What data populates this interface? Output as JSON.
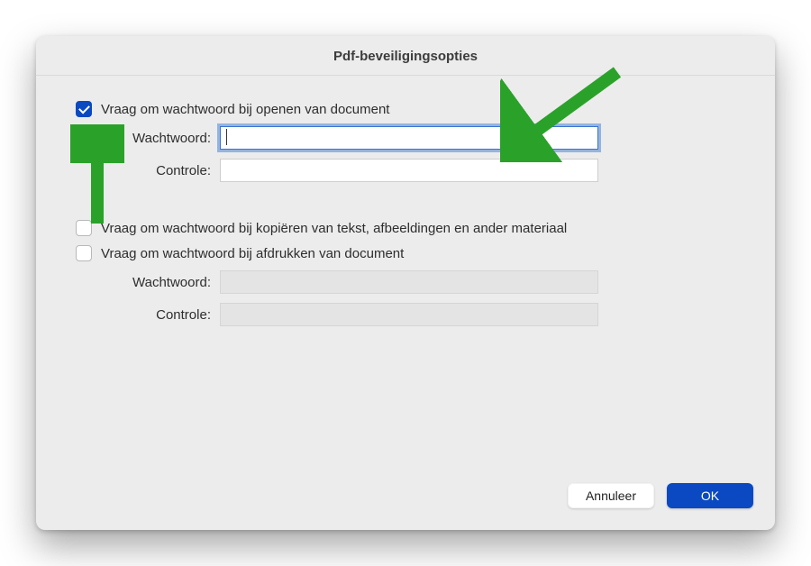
{
  "dialog": {
    "title": "Pdf-beveiligingsopties"
  },
  "open_section": {
    "checkbox_label": "Vraag om wachtwoord bij openen van document",
    "password_label": "Wachtwoord:",
    "verify_label": "Controle:",
    "password_value": "",
    "verify_value": ""
  },
  "permissions_section": {
    "copy_checkbox_label": "Vraag om wachtwoord bij kopiëren van tekst, afbeeldingen en ander materiaal",
    "print_checkbox_label": "Vraag om wachtwoord bij afdrukken van document",
    "password_label": "Wachtwoord:",
    "verify_label": "Controle:",
    "password_value": "",
    "verify_value": ""
  },
  "buttons": {
    "cancel": "Annuleer",
    "ok": "OK"
  },
  "annotations": {
    "arrow_color": "#2aa22a"
  }
}
